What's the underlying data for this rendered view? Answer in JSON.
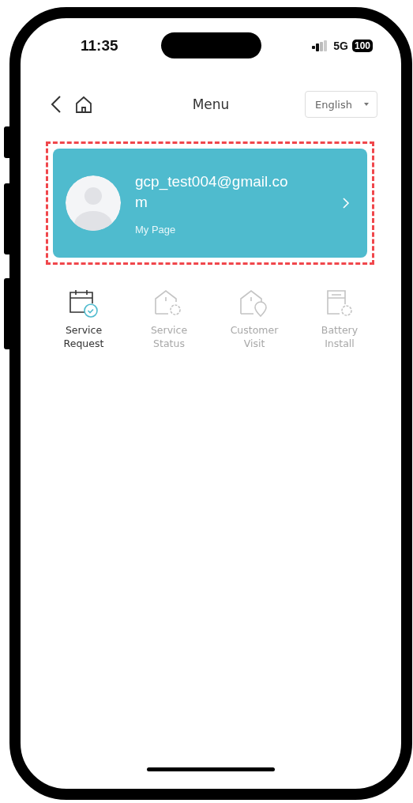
{
  "status_bar": {
    "time": "11:35",
    "network": "5G",
    "battery": "100"
  },
  "header": {
    "title": "Menu",
    "language": "English"
  },
  "profile": {
    "email": "gcp_test004@gmail.com",
    "link": "My Page",
    "highlighted": true
  },
  "menu_items": [
    {
      "label": "Service Request",
      "disabled": false
    },
    {
      "label": "Service Status",
      "disabled": true
    },
    {
      "label": "Customer Visit",
      "disabled": true
    },
    {
      "label": "Battery Install",
      "disabled": true
    }
  ]
}
